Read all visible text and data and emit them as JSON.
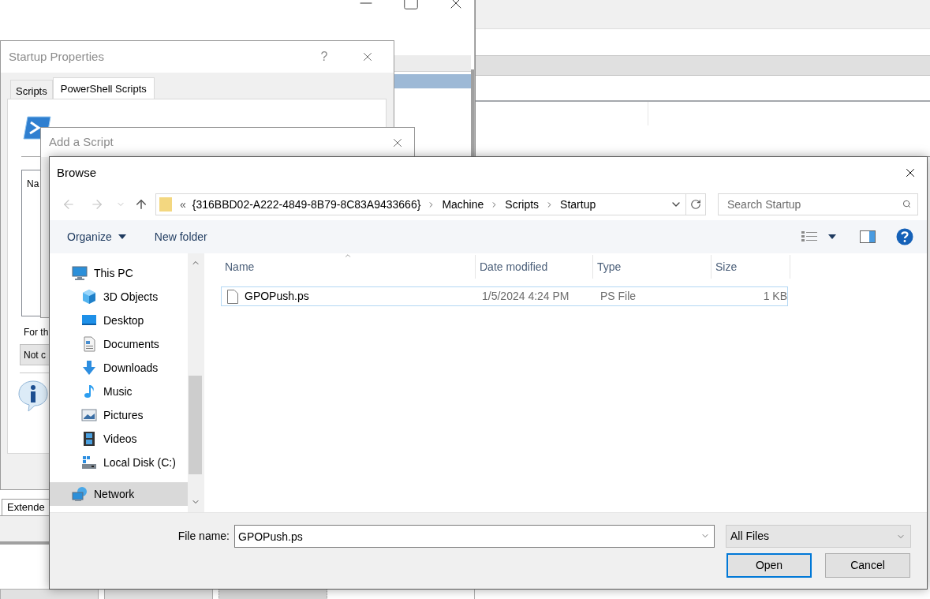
{
  "background_window": {
    "tab": "Extende",
    "buttons": [
      {
        "disabled": false
      },
      {
        "disabled": false
      },
      {
        "disabled": true
      }
    ]
  },
  "startup_properties": {
    "title": "Startup Properties",
    "help": "?",
    "tabs": [
      {
        "label": "Scripts",
        "selected": false
      },
      {
        "label": "PowerShell Scripts",
        "selected": true
      }
    ],
    "list_column": "Na",
    "note": "For th",
    "order_button": "Not c"
  },
  "add_script": {
    "title": "Add a Script"
  },
  "browse": {
    "title": "Browse",
    "address": {
      "overflow": "«",
      "path": [
        "{316BBD02-A222-4849-8B79-8C83A9433666}",
        "Machine",
        "Scripts",
        "Startup"
      ]
    },
    "search": {
      "placeholder": "Search Startup"
    },
    "toolbar": {
      "organize": "Organize",
      "new_folder": "New folder"
    },
    "nav": [
      {
        "label": "This PC",
        "kind": "computer",
        "selected": false,
        "children": [
          {
            "label": "3D Objects",
            "kind": "cube",
            "selected": false
          },
          {
            "label": "Desktop",
            "kind": "desktop",
            "selected": false
          },
          {
            "label": "Documents",
            "kind": "documents",
            "selected": false
          },
          {
            "label": "Downloads",
            "kind": "downloads",
            "selected": false
          },
          {
            "label": "Music",
            "kind": "music",
            "selected": false
          },
          {
            "label": "Pictures",
            "kind": "pictures",
            "selected": false
          },
          {
            "label": "Videos",
            "kind": "videos",
            "selected": false
          },
          {
            "label": "Local Disk (C:)",
            "kind": "disk",
            "selected": false
          }
        ]
      },
      {
        "label": "Network",
        "kind": "network",
        "selected": true
      }
    ],
    "columns": [
      {
        "label": "Name",
        "sorted": true
      },
      {
        "label": "Date modified",
        "sorted": false
      },
      {
        "label": "Type",
        "sorted": false
      },
      {
        "label": "Size",
        "sorted": false
      }
    ],
    "files": [
      {
        "name": "GPOPush.ps",
        "date": "1/5/2024 4:24 PM",
        "type": "PS File",
        "size": "1 KB",
        "focused": true
      }
    ],
    "file_name": {
      "label": "File name:",
      "value": "GPOPush.ps"
    },
    "filter": "All Files",
    "buttons": [
      {
        "label": "Open",
        "default": true
      },
      {
        "label": "Cancel",
        "default": false
      }
    ]
  }
}
